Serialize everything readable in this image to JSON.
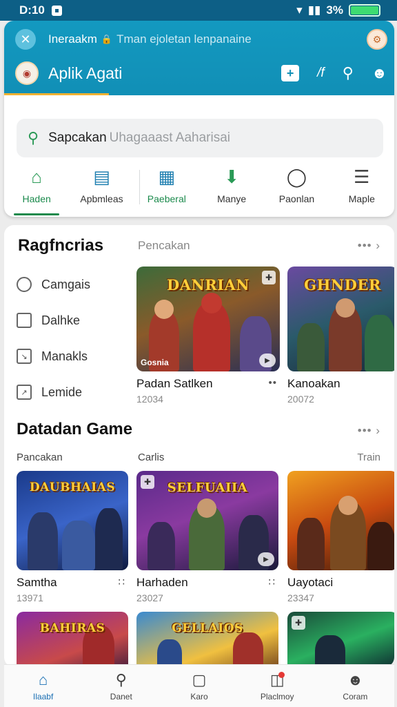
{
  "status_bar": {
    "time": "D:10",
    "battery_text": "3%"
  },
  "browser": {
    "url_bold": "Ineraakm",
    "url_rest": "Tman ejoletan lenpanaine"
  },
  "app": {
    "title": "Aplik Agati",
    "accent": "#1399c0",
    "icons": [
      "add-icon",
      "stats-icon",
      "search-icon",
      "profile-icon"
    ]
  },
  "search": {
    "value": "Sapcakan",
    "placeholder": "Uhagaaast Aaharisai"
  },
  "categories": [
    {
      "label": "Haden",
      "icon": "home-icon",
      "active": true
    },
    {
      "label": "Apbmleas",
      "icon": "list-icon",
      "active": false
    },
    {
      "label": "Paeberal",
      "icon": "chart-icon",
      "active": false
    },
    {
      "label": "Manye",
      "icon": "download-icon",
      "active": false
    },
    {
      "label": "Paonlan",
      "icon": "chat-icon",
      "active": false
    },
    {
      "label": "Maple",
      "icon": "menu-icon",
      "active": false
    }
  ],
  "section1": {
    "title": "Ragfncrias",
    "subtitle": "Pencakan",
    "more": "••• ›",
    "side_items": [
      {
        "label": "Camgais",
        "icon": "lightbulb-icon"
      },
      {
        "label": "Dalhke",
        "icon": "checkbox-icon"
      },
      {
        "label": "Manakls",
        "icon": "arrow-box-icon"
      },
      {
        "label": "Lemide",
        "icon": "expand-icon"
      }
    ],
    "games": [
      {
        "title": "Padan Satlken",
        "meta": "12034",
        "logo": "DANRIAN",
        "tag": "Gosnia"
      },
      {
        "title": "Kanoakan",
        "meta": "20072",
        "logo": "GHNDER"
      }
    ]
  },
  "section2": {
    "title": "Datadan Game",
    "more": "••• ›",
    "columns": [
      "Pancakan",
      "Carlis",
      "Train"
    ],
    "games": [
      {
        "title": "Samtha",
        "meta": "13971",
        "logo": "DAUBHAIAS"
      },
      {
        "title": "Harhaden",
        "meta": "23027",
        "logo": "SELFUAIIA"
      },
      {
        "title": "Uayotaci",
        "meta": "23347",
        "logo": ""
      }
    ],
    "row3": [
      {
        "logo": "BAHIRAS"
      },
      {
        "logo": "GELLAIOS"
      },
      {
        "logo": ""
      }
    ]
  },
  "bottom_nav": [
    {
      "label": "Ilaabf",
      "icon": "home-icon",
      "active": true
    },
    {
      "label": "Danet",
      "icon": "search-icon",
      "active": false
    },
    {
      "label": "Karo",
      "icon": "box-icon",
      "active": false
    },
    {
      "label": "Placlmoy",
      "icon": "bag-icon",
      "active": false,
      "badge": true
    },
    {
      "label": "Coram",
      "icon": "person-icon",
      "active": false
    }
  ]
}
